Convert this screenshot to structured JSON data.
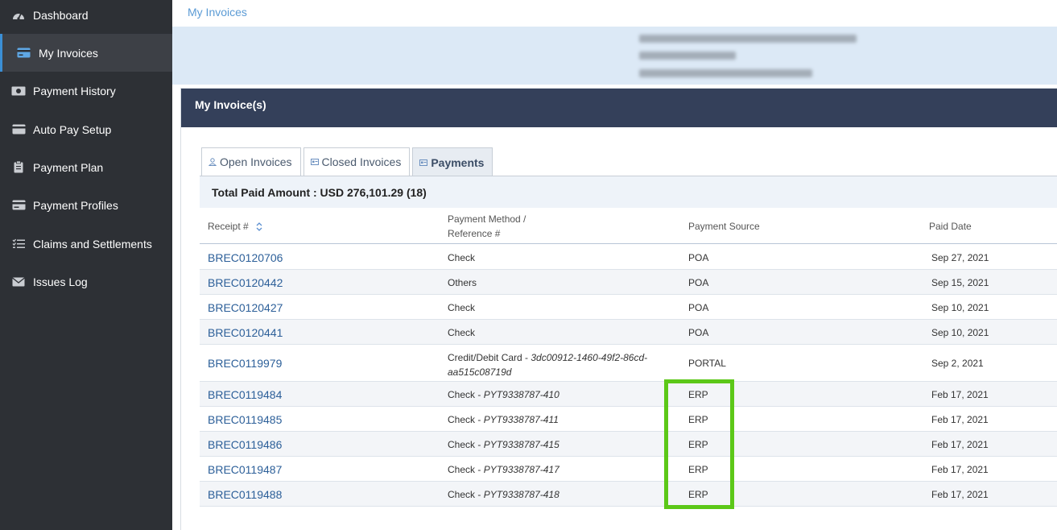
{
  "sidebar": {
    "items": [
      {
        "label": "Dashboard",
        "icon": "dashboard-icon"
      },
      {
        "label": "My Invoices",
        "icon": "credit-card-icon",
        "active": true
      },
      {
        "label": "Payment History",
        "icon": "money-icon"
      },
      {
        "label": "Auto Pay Setup",
        "icon": "card-icon"
      },
      {
        "label": "Payment Plan",
        "icon": "clipboard-icon"
      },
      {
        "label": "Payment Profiles",
        "icon": "profile-card-icon"
      },
      {
        "label": "Claims and Settlements",
        "icon": "checklist-icon"
      },
      {
        "label": "Issues Log",
        "icon": "envelope-icon"
      }
    ]
  },
  "breadcrumb": "My Invoices",
  "card": {
    "title": "My Invoice(s)",
    "tabs": [
      {
        "label": "Open Invoices",
        "icon": "user-icon"
      },
      {
        "label": "Closed Invoices",
        "icon": "invoice-icon"
      },
      {
        "label": "Payments",
        "icon": "payments-icon",
        "active": true
      }
    ],
    "summary": "Total Paid Amount : USD 276,101.29 (18)"
  },
  "table": {
    "headers": {
      "receipt": "Receipt #",
      "method_line1": "Payment Method /",
      "method_line2": "Reference #",
      "source": "Payment Source",
      "date": "Paid Date"
    },
    "rows": [
      {
        "receipt": "BREC0120706",
        "method": "Check",
        "ref": "",
        "source": "POA",
        "date": "Sep 27, 2021"
      },
      {
        "receipt": "BREC0120442",
        "method": "Others",
        "ref": "",
        "source": "POA",
        "date": "Sep 15, 2021"
      },
      {
        "receipt": "BREC0120427",
        "method": "Check",
        "ref": "",
        "source": "POA",
        "date": "Sep 10, 2021"
      },
      {
        "receipt": "BREC0120441",
        "method": "Check",
        "ref": "",
        "source": "POA",
        "date": "Sep 10, 2021"
      },
      {
        "receipt": "BREC0119979",
        "method": "Credit/Debit Card - ",
        "ref": "3dc00912-1460-49f2-86cd-",
        "ref2": "aa515c08719d",
        "source": "PORTAL",
        "date": "Sep 2, 2021"
      },
      {
        "receipt": "BREC0119484",
        "method": "Check - ",
        "ref": "PYT9338787-410",
        "source": "ERP",
        "date": "Feb 17, 2021"
      },
      {
        "receipt": "BREC0119485",
        "method": "Check - ",
        "ref": "PYT9338787-411",
        "source": "ERP",
        "date": "Feb 17, 2021"
      },
      {
        "receipt": "BREC0119486",
        "method": "Check - ",
        "ref": "PYT9338787-415",
        "source": "ERP",
        "date": "Feb 17, 2021"
      },
      {
        "receipt": "BREC0119487",
        "method": "Check - ",
        "ref": "PYT9338787-417",
        "source": "ERP",
        "date": "Feb 17, 2021"
      },
      {
        "receipt": "BREC0119488",
        "method": "Check - ",
        "ref": "PYT9338787-418",
        "source": "ERP",
        "date": "Feb 17, 2021"
      }
    ]
  },
  "colors": {
    "sidebar_bg": "#2d3035",
    "header_bg": "#34405a",
    "link": "#2c5f99",
    "highlight": "#5cc818"
  }
}
